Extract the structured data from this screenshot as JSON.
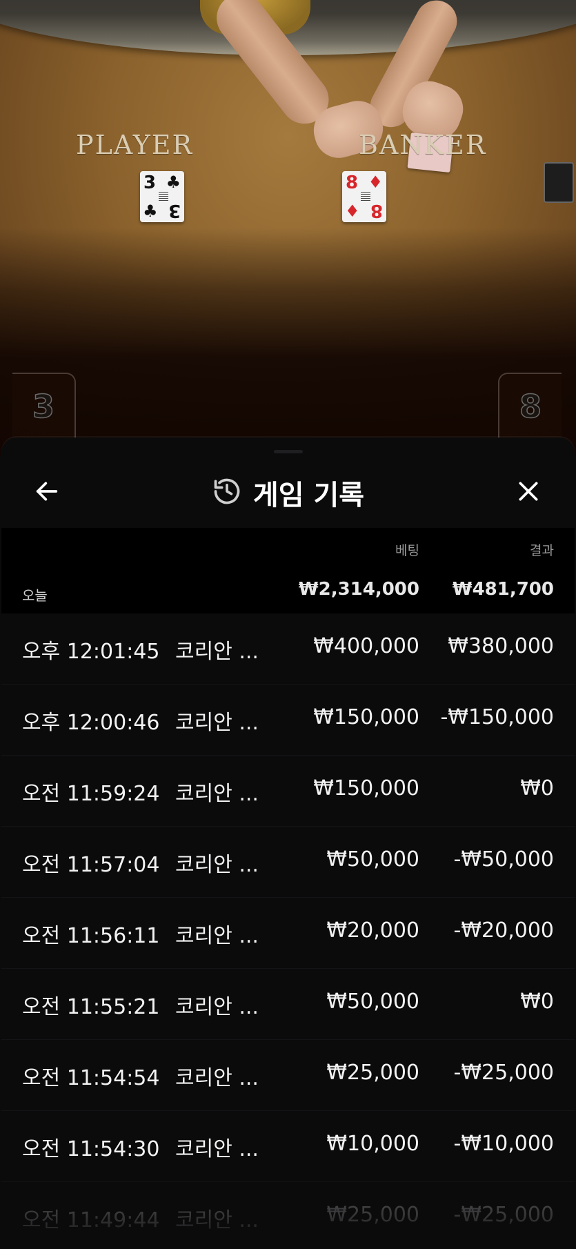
{
  "table": {
    "player_label": "PLAYER",
    "banker_label": "BANKER",
    "player_card": {
      "rank": "3",
      "suit": "♣"
    },
    "banker_card": {
      "rank": "8",
      "suit": "♦"
    },
    "player_score": "3",
    "banker_score": "8"
  },
  "header": {
    "title": "게임 기록",
    "back_icon": "arrow-left-icon",
    "history_icon": "history-icon",
    "close_icon": "close-icon"
  },
  "columns": {
    "bet": "베팅",
    "result": "결과"
  },
  "summary": {
    "label": "오늘",
    "bet_total": "₩2,314,000",
    "result_total": "₩481,700"
  },
  "rows": [
    {
      "time": "오후 12:01:45",
      "game": "코리안 ...",
      "bet": "₩400,000",
      "result": "₩380,000"
    },
    {
      "time": "오후 12:00:46",
      "game": "코리안 ...",
      "bet": "₩150,000",
      "result": "-₩150,000"
    },
    {
      "time": "오전 11:59:24",
      "game": "코리안 ...",
      "bet": "₩150,000",
      "result": "₩0"
    },
    {
      "time": "오전 11:57:04",
      "game": "코리안 ...",
      "bet": "₩50,000",
      "result": "-₩50,000"
    },
    {
      "time": "오전 11:56:11",
      "game": "코리안 ...",
      "bet": "₩20,000",
      "result": "-₩20,000"
    },
    {
      "time": "오전 11:55:21",
      "game": "코리안 ...",
      "bet": "₩50,000",
      "result": "₩0"
    },
    {
      "time": "오전 11:54:54",
      "game": "코리안 ...",
      "bet": "₩25,000",
      "result": "-₩25,000"
    },
    {
      "time": "오전 11:54:30",
      "game": "코리안 ...",
      "bet": "₩10,000",
      "result": "-₩10,000"
    },
    {
      "time": "오전 11:49:44",
      "game": "코리안 ...",
      "bet": "₩25,000",
      "result": "-₩25,000"
    }
  ],
  "colors": {
    "panel_bg": "#0b0b0c",
    "summary_bg": "#000000",
    "text_primary": "#f2f2f2",
    "text_muted": "#9a9a9a"
  }
}
